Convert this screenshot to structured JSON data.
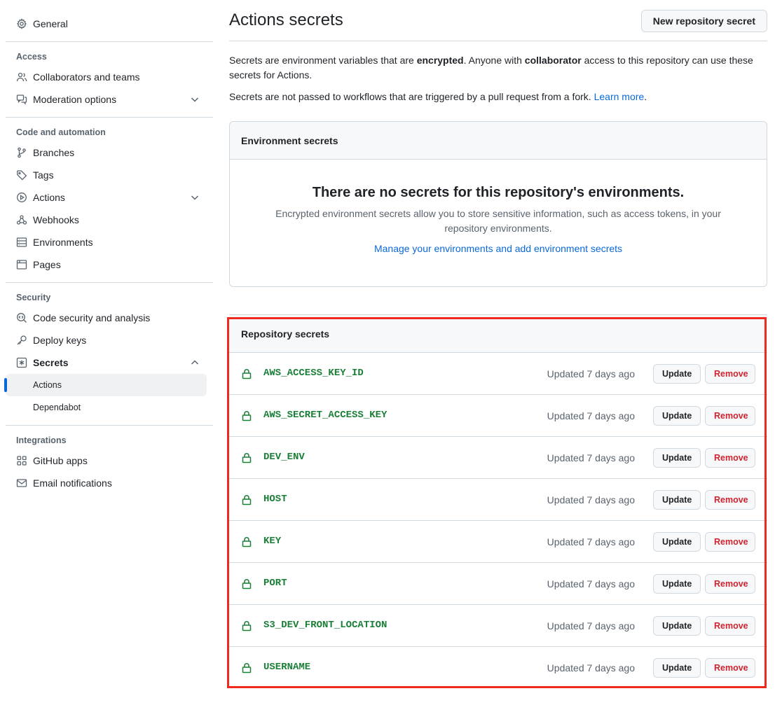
{
  "sidebar": {
    "general": "General",
    "access_heading": "Access",
    "collaborators": "Collaborators and teams",
    "moderation": "Moderation options",
    "code_heading": "Code and automation",
    "branches": "Branches",
    "tags": "Tags",
    "actions": "Actions",
    "webhooks": "Webhooks",
    "environments": "Environments",
    "pages": "Pages",
    "security_heading": "Security",
    "code_security": "Code security and analysis",
    "deploy_keys": "Deploy keys",
    "secrets": "Secrets",
    "secrets_actions": "Actions",
    "secrets_dependabot": "Dependabot",
    "integrations_heading": "Integrations",
    "github_apps": "GitHub apps",
    "email_notifications": "Email notifications"
  },
  "header": {
    "title": "Actions secrets",
    "new_secret_button": "New repository secret"
  },
  "description": {
    "p1_a": "Secrets are environment variables that are ",
    "p1_b": "encrypted",
    "p1_c": ". Anyone with ",
    "p1_d": "collaborator",
    "p1_e": " access to this repository can use these secrets for Actions.",
    "p2_a": "Secrets are not passed to workflows that are triggered by a pull request from a fork. ",
    "p2_link": "Learn more",
    "p2_end": "."
  },
  "environment_secrets": {
    "heading": "Environment secrets",
    "empty_title": "There are no secrets for this repository's environments.",
    "empty_desc": "Encrypted environment secrets allow you to store sensitive information, such as access tokens, in your repository environments.",
    "manage_link": "Manage your environments and add environment secrets"
  },
  "repository_secrets": {
    "heading": "Repository secrets",
    "update_label": "Update",
    "remove_label": "Remove",
    "items": [
      {
        "name": "AWS_ACCESS_KEY_ID",
        "updated": "Updated 7 days ago"
      },
      {
        "name": "AWS_SECRET_ACCESS_KEY",
        "updated": "Updated 7 days ago"
      },
      {
        "name": "DEV_ENV",
        "updated": "Updated 7 days ago"
      },
      {
        "name": "HOST",
        "updated": "Updated 7 days ago"
      },
      {
        "name": "KEY",
        "updated": "Updated 7 days ago"
      },
      {
        "name": "PORT",
        "updated": "Updated 7 days ago"
      },
      {
        "name": "S3_DEV_FRONT_LOCATION",
        "updated": "Updated 7 days ago"
      },
      {
        "name": "USERNAME",
        "updated": "Updated 7 days ago"
      }
    ]
  },
  "colors": {
    "accent": "#0969da",
    "secret_name": "#1a7f37",
    "remove": "#d1242f",
    "highlight_border": "#f0291e"
  }
}
